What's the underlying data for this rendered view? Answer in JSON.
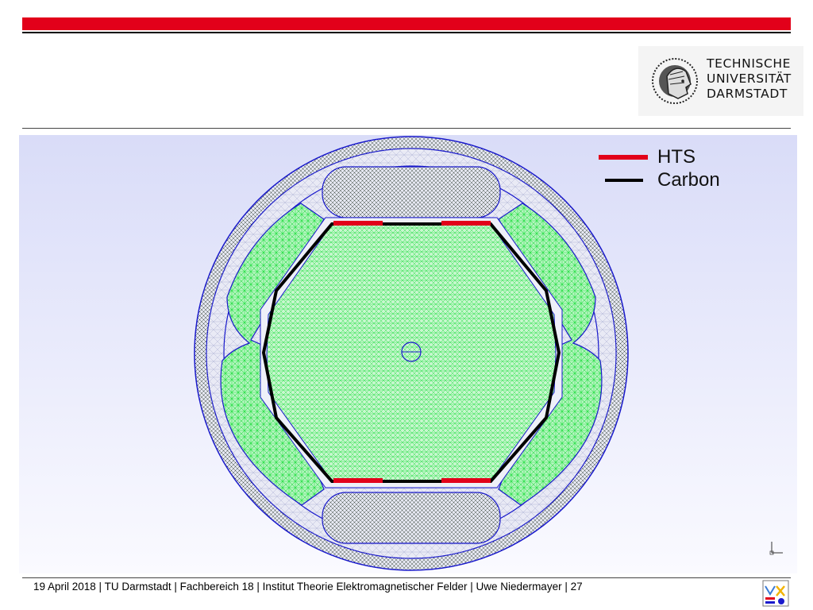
{
  "header": {
    "logo_lines": [
      "TECHNISCHE",
      "UNIVERSITÄT",
      "DARMSTADT"
    ],
    "logo_icon": "athena-head-icon",
    "brand_color": "#e2001a"
  },
  "figure": {
    "icon": "magnet-mesh-cross-section-icon",
    "colors": {
      "background_top": "#d9dcf8",
      "mesh_green": "#2ce04a",
      "boundary_blue": "#1a1acc",
      "hts_red": "#e2001a",
      "carbon_black": "#000000"
    },
    "legend": [
      {
        "label": "HTS",
        "color": "#e2001a"
      },
      {
        "label": "Carbon",
        "color": "#000000"
      }
    ],
    "axis_icon": "xyz-axis-triad-icon"
  },
  "footer": {
    "text": "19 April 2018  |  TU Darmstadt  |  Fachbereich 18  |  Institut Theorie Elektromagnetischer Felder  | Uwe Niedermayer  |  27",
    "logo_icon": "temf-logo-icon"
  }
}
